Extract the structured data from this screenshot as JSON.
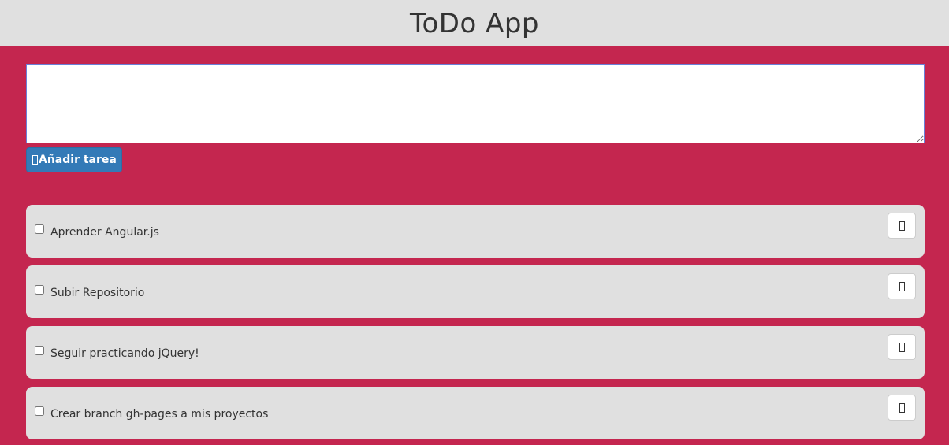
{
  "header": {
    "title": "ToDo App"
  },
  "form": {
    "textarea_value": "",
    "add_button_label": "Añadir tarea",
    "add_button_icon": "plus-icon-missing-glyph"
  },
  "tasks": [
    {
      "label": "Aprender Angular.js",
      "checked": false,
      "delete_icon": "trash-icon-missing-glyph"
    },
    {
      "label": "Subir Repositorio",
      "checked": false,
      "delete_icon": "trash-icon-missing-glyph"
    },
    {
      "label": "Seguir practicando jQuery!",
      "checked": false,
      "delete_icon": "trash-icon-missing-glyph"
    },
    {
      "label": "Crear branch gh-pages a mis proyectos",
      "checked": false,
      "delete_icon": "trash-icon-missing-glyph"
    }
  ],
  "colors": {
    "background": "#c4264f",
    "header": "#e0e0e0",
    "primary_button": "#337ab7",
    "task_card": "#e0e0e0"
  }
}
